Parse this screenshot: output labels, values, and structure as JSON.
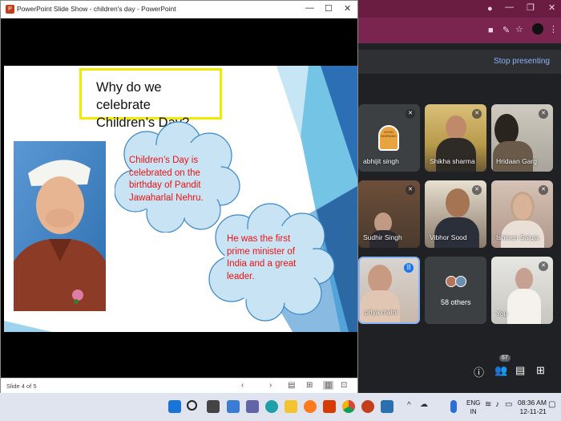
{
  "ppt": {
    "title": "PowerPoint Slide Show  -  children's day  -  PowerPoint",
    "status": "Slide 4 of 5"
  },
  "slide": {
    "title_line1": "Why do we celebrate",
    "title_line2": "Children’s Day?",
    "bubble1": [
      "Children’s Day is",
      "celebrated on the",
      "birthday of Pandit",
      "Jawaharlal Nehru."
    ],
    "bubble2": [
      "He was the first",
      "prime minister of",
      "India and a great",
      "leader."
    ]
  },
  "meet": {
    "stop_presenting": "Stop presenting",
    "good_morning": "GOOD MORNING",
    "participant_badge": "67",
    "participants": [
      {
        "name": "abhijit singh"
      },
      {
        "name": "Shikha sharma"
      },
      {
        "name": "Hridaan Garg"
      },
      {
        "name": "Sudhir Singh"
      },
      {
        "name": "Vibhor Sood"
      },
      {
        "name": "Ishleen Saluja"
      },
      {
        "name": "priya maini"
      },
      {
        "name": "58 others"
      },
      {
        "name": "You"
      }
    ]
  },
  "taskbar": {
    "lang1": "ENG",
    "lang2": "IN",
    "time": "08:36 AM",
    "date": "12-11-21"
  }
}
